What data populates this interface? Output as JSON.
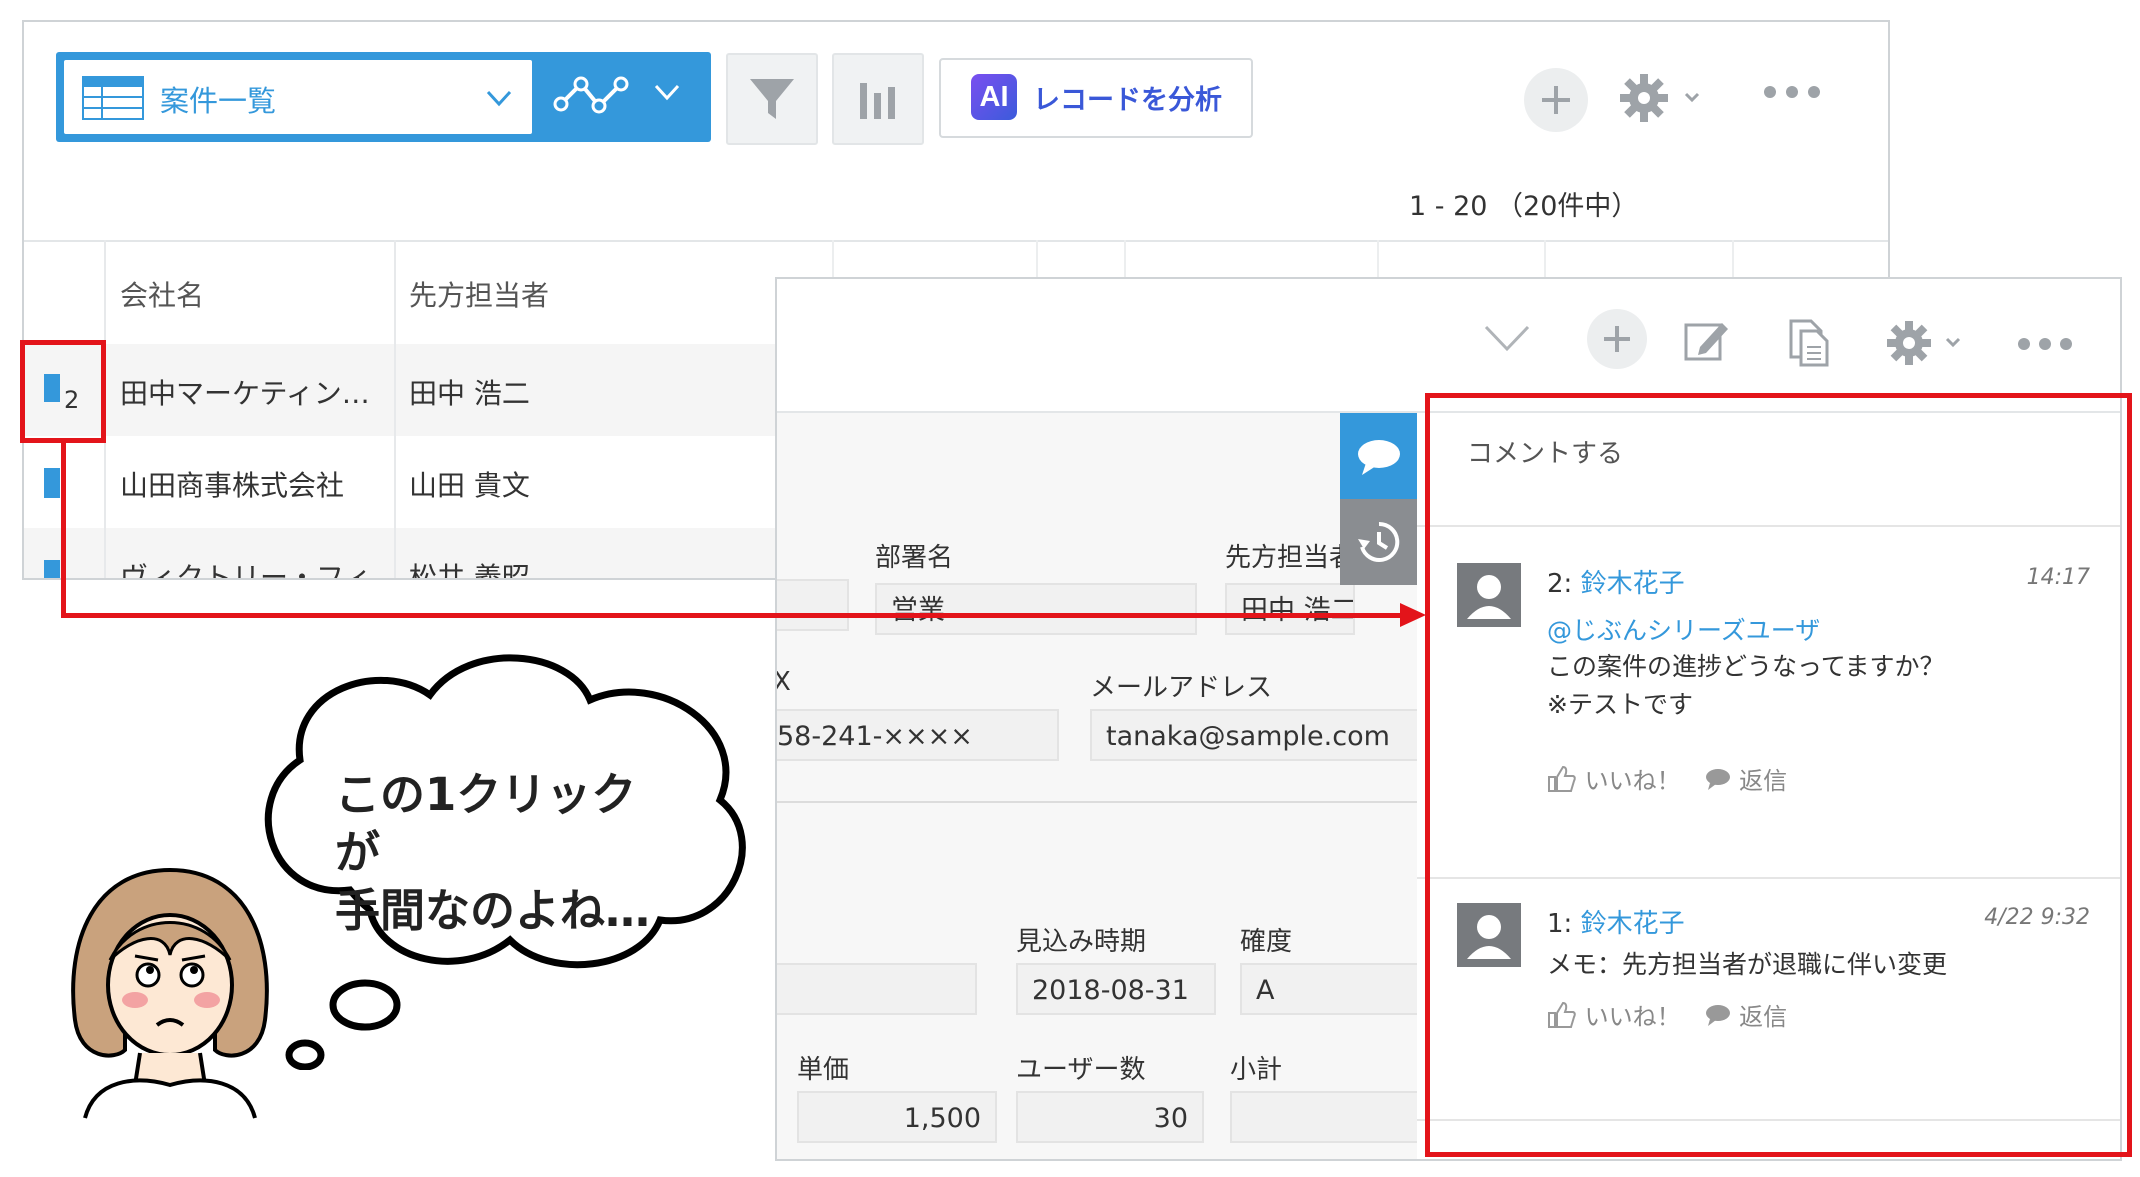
{
  "list": {
    "view_name": "案件一覧",
    "ai_button_badge": "AI",
    "ai_button_label": "レコードを分析",
    "pager": "1 - 20 （20件中）",
    "columns": [
      "会社名",
      "先方担当者"
    ],
    "rows": [
      {
        "company": "田中マーケティン…",
        "contact": "田中 浩二"
      },
      {
        "company": "山田商事株式会社",
        "contact": "山田 貴文"
      },
      {
        "company": "ヴィクトリー・フィ",
        "contact": "松井 義昭"
      }
    ],
    "comment_count": "2"
  },
  "detail": {
    "fields": {
      "department_label": "部署名",
      "department_value": "営業",
      "contact_label": "先方担当者",
      "contact_value": "田中 浩二",
      "fax_label_fragment": "X",
      "phone_value_fragment": "58-241-××××",
      "email_label": "メールアドレス",
      "email_value": "tanaka@sample.com",
      "expected_label": "見込み時期",
      "expected_value": "2018-08-31",
      "certainty_label": "確度",
      "certainty_value": "A",
      "unit_price_label": "単価",
      "unit_price_value": "1,500",
      "users_label": "ユーザー数",
      "users_value": "30",
      "subtotal_label": "小計"
    },
    "comments": {
      "placeholder": "コメントする",
      "items": [
        {
          "number": "2:",
          "author": "鈴木花子",
          "time": "14:17",
          "mention": "@じぶんシリーズユーザ",
          "lines": [
            "この案件の進捗どうなってますか？",
            "※テストです"
          ],
          "like_label": "いいね！",
          "reply_label": "返信"
        },
        {
          "number": "1:",
          "author": "鈴木花子",
          "time": "4/22 9:32",
          "lines": [
            "メモ：先方担当者が退職に伴い変更"
          ],
          "like_label": "いいね！",
          "reply_label": "返信"
        }
      ]
    }
  },
  "annotation": {
    "speech_line1": "この1クリックが",
    "speech_line2": "手間なのよね…",
    "highlight_color": "#e3141a"
  },
  "icons": [
    "grid-icon",
    "chevron-down-icon",
    "graph-icon",
    "filter-icon",
    "bar-chart-icon",
    "plus-icon",
    "gear-icon",
    "more-icon",
    "comment-icon",
    "history-icon",
    "edit-icon",
    "copy-icon",
    "avatar-icon",
    "thumbs-up-icon",
    "reply-icon"
  ],
  "colors": {
    "accent": "#3498db",
    "highlight": "#e3141a"
  }
}
